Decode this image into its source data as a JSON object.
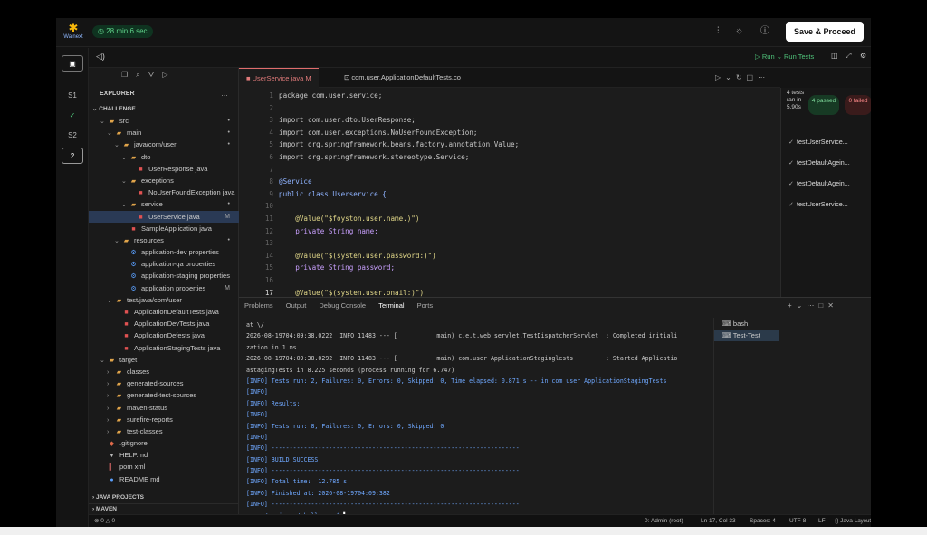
{
  "topbar": {
    "brand": "Walnext",
    "timer": "28 min 6 sec",
    "save_label": "Save & Proceed",
    "run_label": "Run",
    "run_tests_label": "Run Tests"
  },
  "activity": {
    "s1": "S1",
    "s2": "S2",
    "num": "2"
  },
  "explorer": {
    "title": "EXPLORER",
    "section_challenge": "CHALLENGE",
    "section_java": "JAVA PROJECTS",
    "section_maven": "MAVEN",
    "tree": [
      {
        "label": "src",
        "depth": 1,
        "tw": "⌄",
        "icon": "folder",
        "status": "•"
      },
      {
        "label": "main",
        "depth": 2,
        "tw": "⌄",
        "icon": "folder",
        "status": "•"
      },
      {
        "label": "java/com/user",
        "depth": 3,
        "tw": "⌄",
        "icon": "folder",
        "status": "•"
      },
      {
        "label": "dto",
        "depth": 4,
        "tw": "⌄",
        "icon": "folder",
        "status": ""
      },
      {
        "label": "UserResponse java",
        "depth": 5,
        "tw": "",
        "icon": "java",
        "status": ""
      },
      {
        "label": "exceptions",
        "depth": 4,
        "tw": "⌄",
        "icon": "folder",
        "status": ""
      },
      {
        "label": "NoUserFoundException java",
        "depth": 5,
        "tw": "",
        "icon": "java",
        "status": ""
      },
      {
        "label": "service",
        "depth": 4,
        "tw": "⌄",
        "icon": "folder",
        "status": "•"
      },
      {
        "label": "UserService java",
        "depth": 5,
        "tw": "",
        "icon": "java",
        "status": "M",
        "selected": true
      },
      {
        "label": "SampleApplication java",
        "depth": 4,
        "tw": "",
        "icon": "java",
        "status": ""
      },
      {
        "label": "resources",
        "depth": 3,
        "tw": "⌄",
        "icon": "folder",
        "status": "•"
      },
      {
        "label": "application-dev properties",
        "depth": 4,
        "tw": "",
        "icon": "gear",
        "status": ""
      },
      {
        "label": "application-qa properties",
        "depth": 4,
        "tw": "",
        "icon": "gear",
        "status": ""
      },
      {
        "label": "application-staging properties",
        "depth": 4,
        "tw": "",
        "icon": "gear",
        "status": ""
      },
      {
        "label": "application properties",
        "depth": 4,
        "tw": "",
        "icon": "gear",
        "status": "M"
      },
      {
        "label": "test/java/com/user",
        "depth": 2,
        "tw": "⌄",
        "icon": "folder",
        "status": ""
      },
      {
        "label": "ApplicationDefaultTests java",
        "depth": 3,
        "tw": "",
        "icon": "java",
        "status": ""
      },
      {
        "label": "ApplicationDevTests java",
        "depth": 3,
        "tw": "",
        "icon": "java",
        "status": ""
      },
      {
        "label": "ApplicationDefests java",
        "depth": 3,
        "tw": "",
        "icon": "java",
        "status": ""
      },
      {
        "label": "ApplicationStagingTests java",
        "depth": 3,
        "tw": "",
        "icon": "java",
        "status": ""
      },
      {
        "label": "target",
        "depth": 1,
        "tw": "⌄",
        "icon": "folder",
        "status": ""
      },
      {
        "label": "classes",
        "depth": 2,
        "tw": "›",
        "icon": "folder",
        "status": ""
      },
      {
        "label": "generated-sources",
        "depth": 2,
        "tw": "›",
        "icon": "folder",
        "status": ""
      },
      {
        "label": "generated-test-sources",
        "depth": 2,
        "tw": "›",
        "icon": "folder",
        "status": ""
      },
      {
        "label": "maven-status",
        "depth": 2,
        "tw": "›",
        "icon": "folder",
        "status": ""
      },
      {
        "label": "surefire-reports",
        "depth": 2,
        "tw": "›",
        "icon": "folder",
        "status": ""
      },
      {
        "label": "test-classes",
        "depth": 2,
        "tw": "›",
        "icon": "folder",
        "status": ""
      },
      {
        "label": ".gitignore",
        "depth": 1,
        "tw": "",
        "icon": "git",
        "status": ""
      },
      {
        "label": "HELP.md",
        "depth": 1,
        "tw": "",
        "icon": "md",
        "status": ""
      },
      {
        "label": "pom xml",
        "depth": 1,
        "tw": "",
        "icon": "xml",
        "status": ""
      },
      {
        "label": "README md",
        "depth": 1,
        "tw": "",
        "icon": "info",
        "status": ""
      }
    ]
  },
  "editor": {
    "tabs": [
      {
        "label": "UserService java",
        "status": "M"
      },
      {
        "label": "com.user.ApplicationDefaultTests.co"
      }
    ],
    "lines": [
      {
        "n": "1",
        "t": "package com.user.service;"
      },
      {
        "n": "2",
        "t": ""
      },
      {
        "n": "3",
        "t": "import com.user.dto.UserResponse;"
      },
      {
        "n": "4",
        "t": "import com.user.exceptions.NoUserFoundException;"
      },
      {
        "n": "5",
        "t": "import org.springframework.beans.factory.annotation.Value;"
      },
      {
        "n": "6",
        "t": "import org.springframework.stereotype.Service;"
      },
      {
        "n": "7",
        "t": ""
      },
      {
        "n": "8",
        "t": "@Service"
      },
      {
        "n": "9",
        "t": "public class Userservice {"
      },
      {
        "n": "10",
        "t": ""
      },
      {
        "n": "11",
        "t": "    @Value(\"$foyston.user.name.)\")"
      },
      {
        "n": "12",
        "t": "    private String name;"
      },
      {
        "n": "13",
        "t": ""
      },
      {
        "n": "14",
        "t": "    @Value(\"$(systen.user.password:)\")"
      },
      {
        "n": "15",
        "t": "    private String password;"
      },
      {
        "n": "16",
        "t": ""
      },
      {
        "n": "17",
        "t": "    @Value(\"$(systen.user.onail:)\")"
      }
    ]
  },
  "tests": {
    "summary": "4 tests ran in 5.90s",
    "passed": "4 passed",
    "failed": "0 failed",
    "items": [
      "testUserService...",
      "testDefaultAgein...",
      "testDefaultAgein...",
      "testUserService..."
    ]
  },
  "panel": {
    "tabs": [
      "Problems",
      "Output",
      "Debug Console",
      "Terminal",
      "Ports"
    ],
    "active": "Terminal",
    "terminals": [
      "bash",
      "Test-Test"
    ],
    "lines": [
      "at \\/",
      "2026-08-19704:09:38.0222  INFO 11483 --- [           main) c.e.t.web servlet.TestDispatcherServlet  : Completed initiali",
      "zation in 1 ms",
      "2026-08-19704:09:38.0292  INFO 11483 --- [           main) com.user ApplicationStaginglests         : Started Applicatio",
      "astagingTests in 8.225 seconds (process running for 6.747)",
      "[INFO] Tests run: 2, Failures: 0, Errors: 0, Skipped: 0, Time elapsed: 0.871 s -- in com user ApplicationStagingTests",
      "[INFO]",
      "[INFO] Results:",
      "[INFO]",
      "[INFO] Tests run: 8, Failures: 0, Errors: 0, Skipped: 0",
      "[INFO]",
      "[INFO] ---------------------------------------------------------------------",
      "[INFO] BUILD SUCCESS",
      "[INFO] ---------------------------------------------------------------------",
      "[INFO] Total time:  12.785 s",
      "[INFO] Finished at: 2026-08-19704:09:382",
      "[INFO] ---------------------------------------------------------------------",
      "user /projects/challange $ "
    ]
  },
  "status": {
    "left": "⊗ 0 △ 0",
    "admin": "0: Admin (root)",
    "pos": "Ln 17, Col 33",
    "spaces": "Spaces: 4",
    "enc": "UTF-8",
    "eol": "LF",
    "lang": "{} Java",
    "layout": "Layout: U.S"
  }
}
